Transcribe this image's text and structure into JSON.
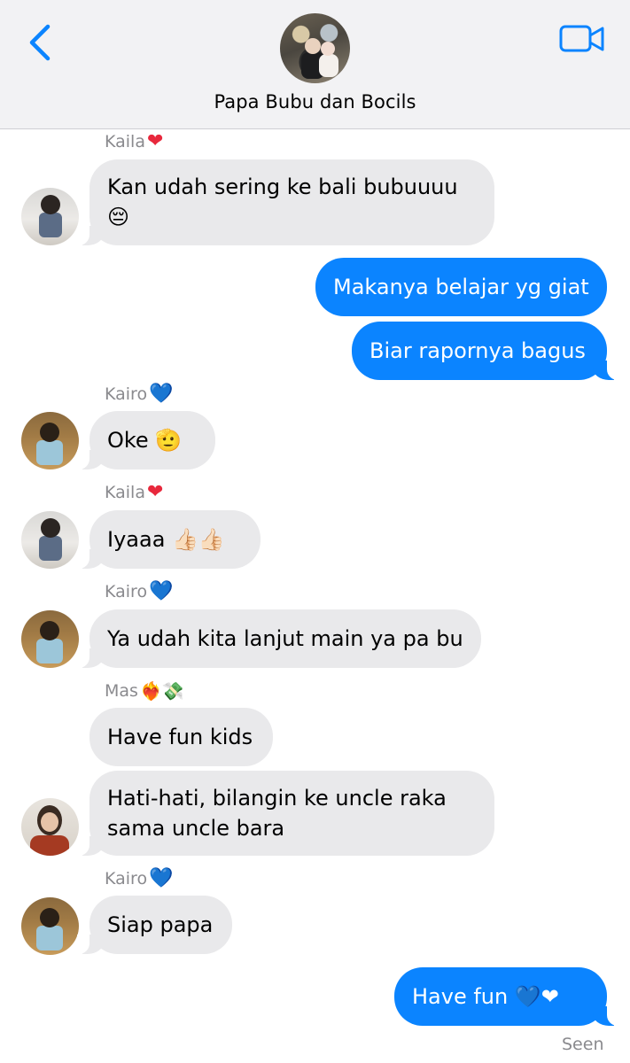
{
  "header": {
    "title": "Papa Bubu dan Bocils",
    "back_icon": "chevron-left-icon",
    "video_icon": "video-camera-icon",
    "accent_color": "#0b84ff"
  },
  "messages": [
    {
      "sender": "Kaila",
      "sender_emoji": "❤",
      "text": "Kan udah sering ke bali bubuuuu",
      "text_line2": "😔",
      "direction": "incoming"
    },
    {
      "text": "Makanya belajar yg giat",
      "direction": "outgoing"
    },
    {
      "text": "Biar rapornya bagus",
      "direction": "outgoing"
    },
    {
      "sender": "Kairo",
      "sender_emoji": "💙",
      "text": "Oke 🫡",
      "direction": "incoming"
    },
    {
      "sender": "Kaila",
      "sender_emoji": "❤",
      "text": "Iyaaa 👍🏻👍🏻",
      "direction": "incoming"
    },
    {
      "sender": "Kairo",
      "sender_emoji": "💙",
      "text": "Ya udah kita lanjut main ya pa bu",
      "direction": "incoming"
    },
    {
      "sender": "Mas",
      "sender_emoji": "❤️‍🔥💸",
      "text": "Have fun kids",
      "direction": "incoming"
    },
    {
      "text": "Hati-hati, bilangin ke uncle raka",
      "text_line2": "sama uncle bara",
      "direction": "incoming"
    },
    {
      "sender": "Kairo",
      "sender_emoji": "💙",
      "text": "Siap papa",
      "direction": "incoming"
    },
    {
      "text": "Have fun 💙❤",
      "direction": "outgoing"
    }
  ],
  "status": {
    "seen": "Seen"
  }
}
